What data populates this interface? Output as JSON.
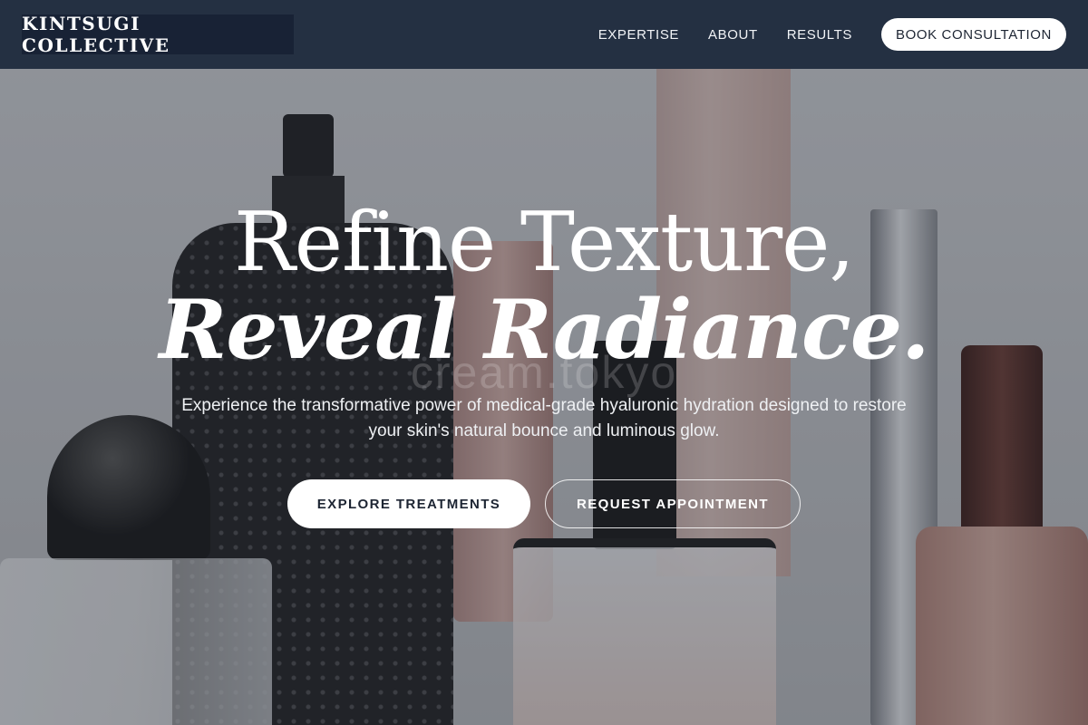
{
  "header": {
    "brand": "KINTSUGI COLLECTIVE",
    "nav": [
      {
        "label": "EXPERTISE"
      },
      {
        "label": "ABOUT"
      },
      {
        "label": "RESULTS"
      }
    ],
    "cta": "BOOK CONSULTATION"
  },
  "hero": {
    "headline_line1": "Refine Texture,",
    "headline_line2": "Reveal Radiance.",
    "watermark": "cream.tokyo",
    "subtext": "Experience the transformative power of medical-grade hyaluronic hydration designed to restore your skin's natural bounce and luminous glow.",
    "primary_button": "EXPLORE TREATMENTS",
    "secondary_button": "REQUEST APPOINTMENT"
  },
  "colors": {
    "header_bg": "#243042",
    "logo_bg": "#182235",
    "button_bg": "#ffffff",
    "button_text": "#1d2533"
  }
}
